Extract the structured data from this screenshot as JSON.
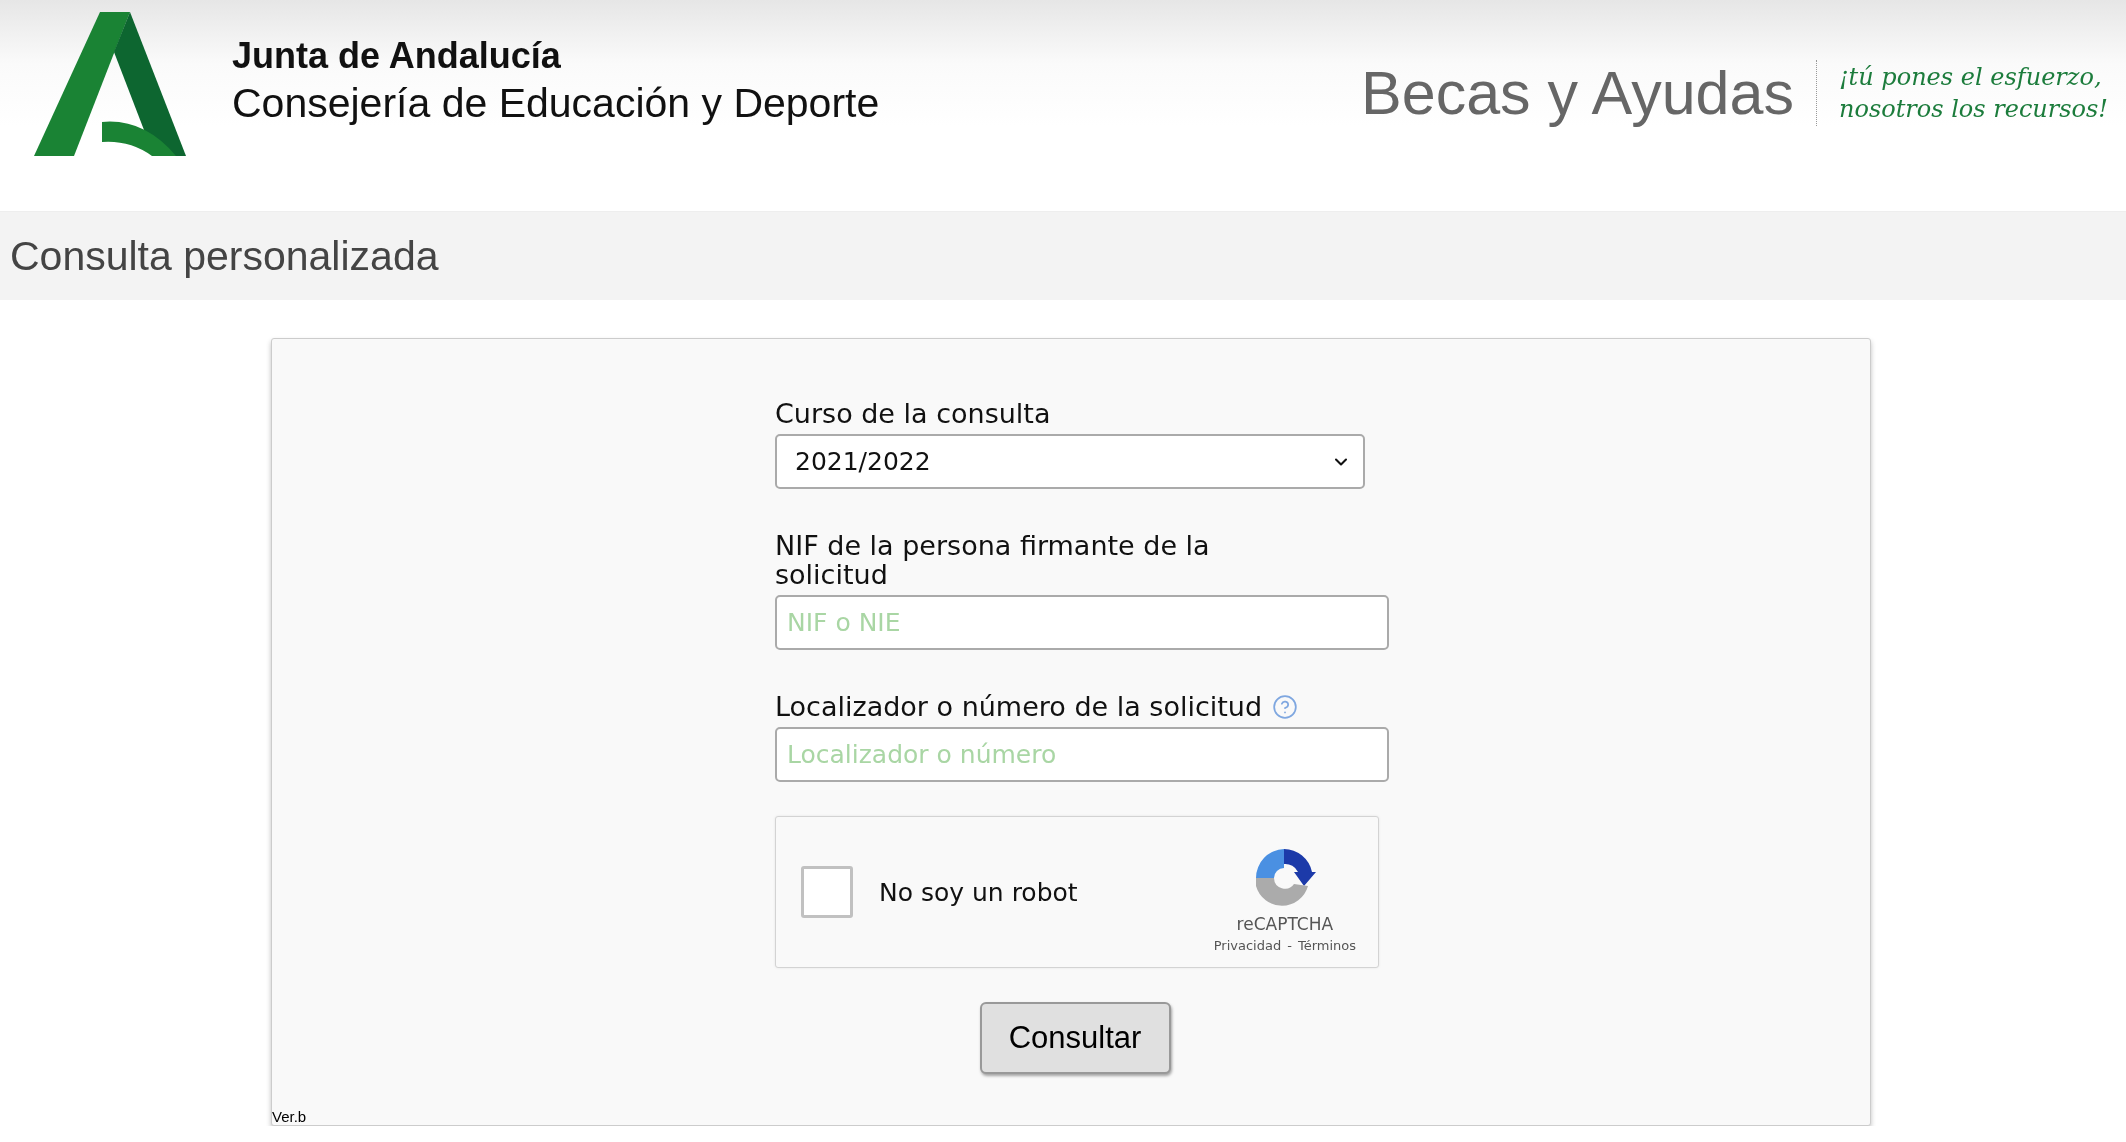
{
  "header": {
    "org": "Junta de Andalucía",
    "department": "Consejería de Educación y Deporte",
    "program": "Becas y Ayudas",
    "slogan": [
      "¡tú pones el esfuerzo,",
      "nosotros los recursos!"
    ]
  },
  "page_title": "Consulta personalizada",
  "form": {
    "fields": [
      {
        "kind": "select",
        "label": "Curso de la consulta",
        "value": "2021/2022"
      },
      {
        "kind": "text",
        "label": "NIF de la persona firmante de la solicitud",
        "placeholder": "NIF o NIE"
      },
      {
        "kind": "text",
        "label": "Localizador o número de la solicitud",
        "placeholder": "Localizador o número",
        "help": true
      }
    ],
    "captcha": {
      "label": "No soy un robot",
      "checked": false,
      "brand": "reCAPTCHA",
      "links": [
        "Privacidad",
        "Términos"
      ],
      "separator": "-"
    },
    "submit": "Consultar"
  },
  "version": "Ver.b"
}
